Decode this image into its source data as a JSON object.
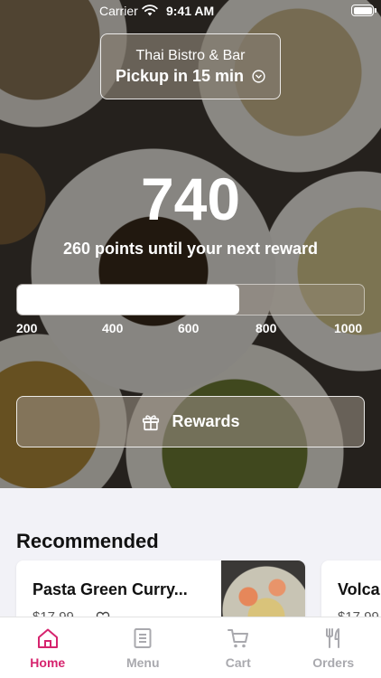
{
  "status_bar": {
    "carrier": "Carrier",
    "time": "9:41 AM"
  },
  "header": {
    "restaurant_name": "Thai Bistro & Bar",
    "pickup": "Pickup in 15 min"
  },
  "rewards": {
    "points": "740",
    "caption": "260 points until your next reward",
    "progress_fraction": 0.64,
    "ticks": [
      "200",
      "400",
      "600",
      "800",
      "1000"
    ],
    "button_label": "Rewards"
  },
  "recommended": {
    "title": "Recommended",
    "items": [
      {
        "name": "Pasta Green Curry...",
        "price": "$17.99"
      },
      {
        "name": "Volca",
        "price": "$17.99"
      }
    ]
  },
  "tab_bar": {
    "active_color": "#d6246e",
    "inactive_color": "#a9a9ae",
    "tabs": [
      {
        "label": "Home",
        "icon": "home-icon"
      },
      {
        "label": "Menu",
        "icon": "menu-icon"
      },
      {
        "label": "Cart",
        "icon": "cart-icon"
      },
      {
        "label": "Orders",
        "icon": "orders-icon"
      }
    ]
  }
}
